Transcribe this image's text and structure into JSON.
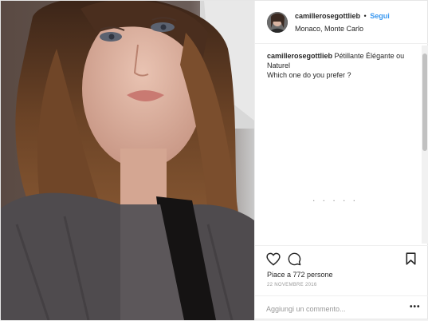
{
  "post": {
    "username": "camillerosegottlieb",
    "separator": "•",
    "follow_label": "Segui",
    "location": "Monaco, Monte Carlo",
    "caption": {
      "username": "camillerosegottlieb",
      "line1": " Pétillante Élégante ou Naturel",
      "line2": "Which one do you prefer ?"
    },
    "loading_indicator": ". . . . .",
    "likes": "Piace a 772 persone",
    "date": "22 NOVEMBRE 2016",
    "comment_placeholder": "Aggiungi un commento...",
    "more_label": "•••"
  },
  "colors": {
    "accent": "#3897f0",
    "text": "#262626",
    "muted": "#999999",
    "border": "#efefef"
  },
  "icons": [
    "heart-icon",
    "comment-icon",
    "bookmark-icon",
    "more-options-icon"
  ]
}
